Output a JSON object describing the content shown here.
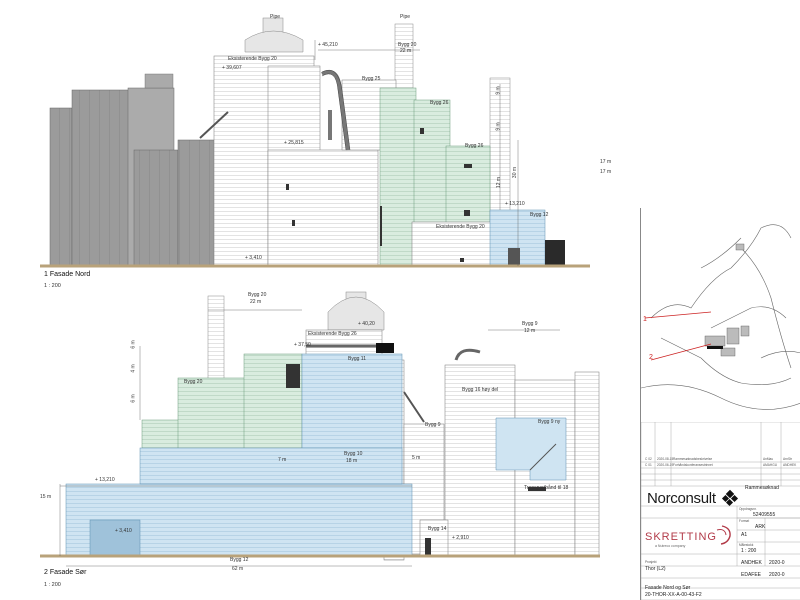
{
  "views": {
    "north": {
      "title": "1 Fasade Nord",
      "scale": "1 : 200",
      "labels": {
        "pipe1": "Pipe",
        "pipe2": "Pipe",
        "eksist20": "Eksisterende Bygg 20",
        "bygg20a": "Bygg 20",
        "bygg20b": "22 m",
        "bygg25": "Bygg 25",
        "bygg26": "Bygg 26",
        "bygg29": "Bygg 26",
        "bygg12": "Bygg 12",
        "eksist29": "Eksisterende Bygg 20",
        "lvl1": "+ 45,210",
        "lvl2": "+ 39,607",
        "lvl3": "+ 25,815",
        "lvl4": "+ 13,210",
        "lvl5": "+ 3,410",
        "dim1": "9 m",
        "dim2": "9 m",
        "dim3": "12 m",
        "dim4": "30 m",
        "dim5": "17 m",
        "dim6": "17 m"
      }
    },
    "south": {
      "title": "2 Fasade Sør",
      "scale": "1 : 200",
      "labels": {
        "bygg20": "Bygg 20",
        "bygg20w": "22 m",
        "eksist26": "Eksisterende Bygg 26",
        "bygg9": "Bygg 9",
        "bygg9w": "12 m",
        "lvl1": "+ 40,20",
        "lvl2": "+ 37,50",
        "lvl3": "+ 13,210",
        "lvl4": "+ 3,410",
        "lvl5": "+ 2,910",
        "bygg20b": "Bygg 20",
        "bygg11": "Bygg 11",
        "bygg16": "Bygg 16 høy del",
        "bygg9n": "Bygg 9",
        "bygg9ny": "Bygg 9 ny",
        "bygg10": "Bygg 10",
        "bygg10w": "18 m",
        "d7m": "7 m",
        "d15m": "15 m",
        "d5m": "5 m",
        "transport": "Transportbånd til 18",
        "bygg14": "Bygg 14",
        "bygg12": "Bygg 12",
        "bygg12w": "62 m",
        "d6a": "6 m",
        "d4": "4 m",
        "d6b": "6 m"
      }
    }
  },
  "title_block": {
    "rev_rows": [
      {
        "rev": "C 02",
        "date": "2020-08-15",
        "desc": "Rammesøknadsbeskrivelse",
        "by": "AnMau",
        "chk": "ArnStr"
      },
      {
        "rev": "C 01",
        "date": "2020-06-19",
        "desc": "Forhåndskonferansestrinnet",
        "by": "AMAHGU",
        "chk": "ANDHEK"
      }
    ],
    "company": "Norconsult",
    "client_logo": "SKRETTING",
    "client_sub": "a Nutreco company",
    "rammesoknad": "Rammesøknad",
    "project_no_label": "Oppdragsnr.",
    "project_no": "52409555",
    "discipline": "ARK",
    "size_label": "Format",
    "size": "A1",
    "scale_label": "Målestokk",
    "scale": "1 : 200",
    "project_label": "Prosjekt",
    "project": "Thor (L2)",
    "drawn_by": "ANDHEK",
    "checked_by": "EDAFEE",
    "drawing_title": "Fasade Nord og Sør",
    "drawing_no": "20-THOR-XX-A-00-43-F2",
    "date1": "2020-0",
    "date2": "2020-0"
  },
  "map": {
    "marker1": "1",
    "marker2": "2"
  },
  "colors": {
    "existing": "#9a9a9a",
    "new_green": "#d9ecdf",
    "new_blue": "#cfe4f2",
    "ground": "#b8a27a",
    "section_red": "#cc2222"
  }
}
